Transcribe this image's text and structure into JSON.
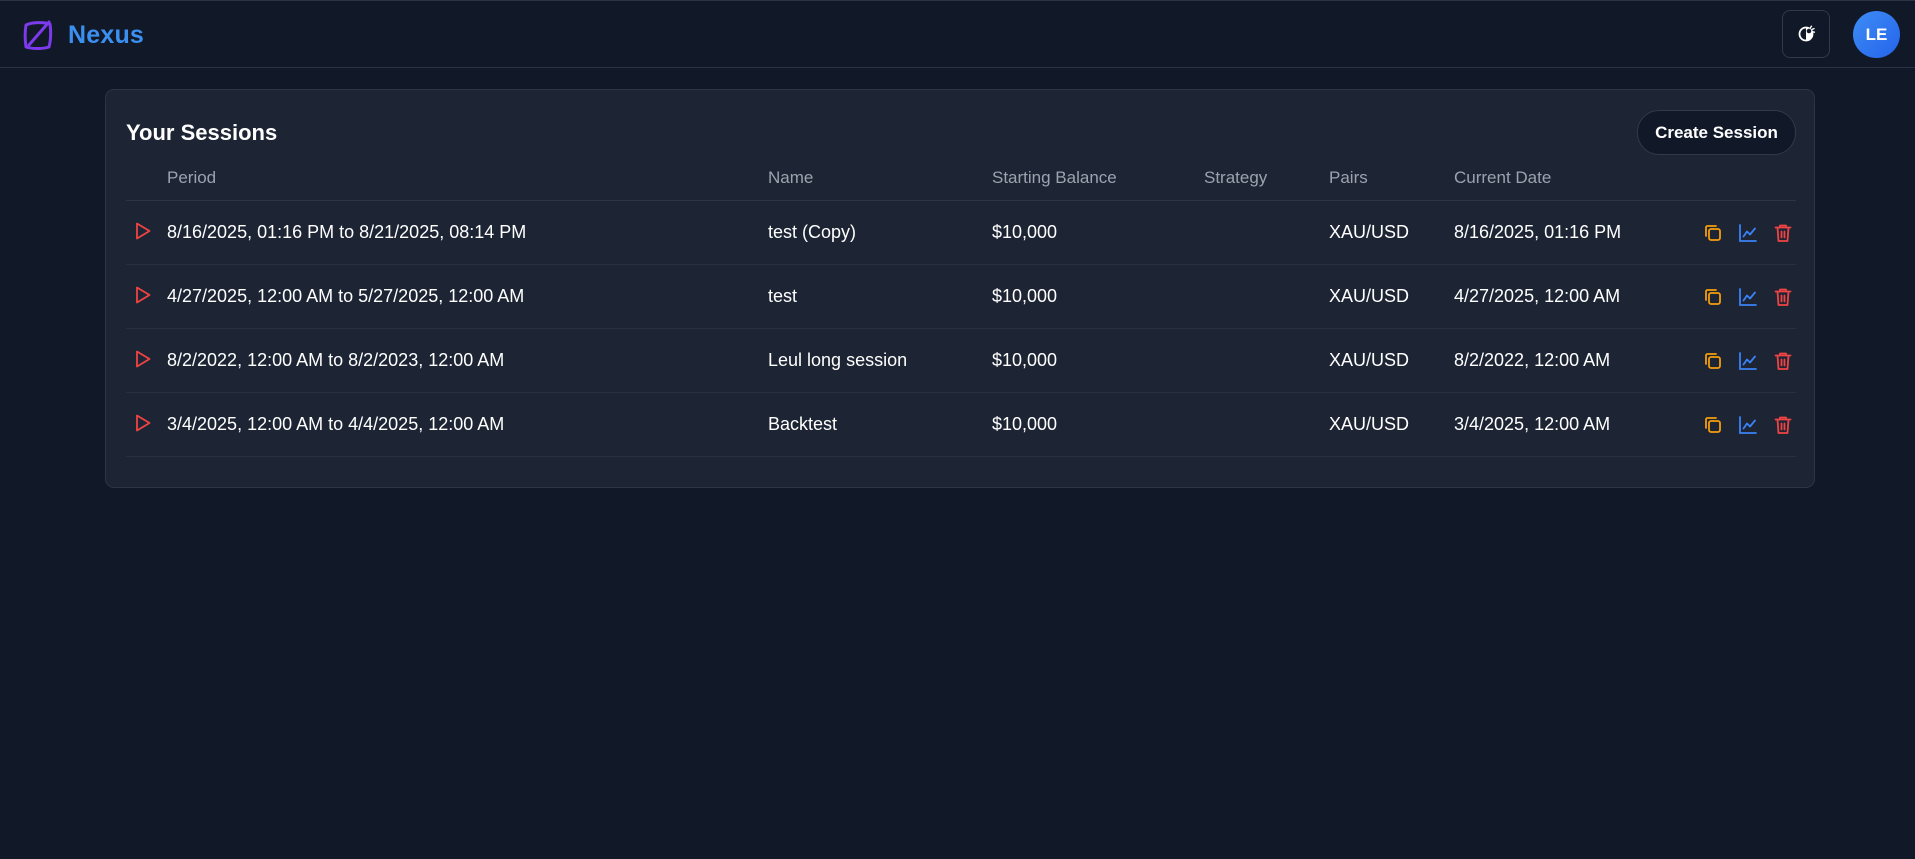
{
  "app": {
    "name": "Nexus",
    "user_initials": "LE",
    "colors": {
      "background": "#111827",
      "card": "#1d2433",
      "brand": "#3b8ff0",
      "logo": "#7c3aed",
      "play": "#ef4444",
      "copy": "#f59e0b",
      "chart": "#3b82f6",
      "delete": "#ef4444"
    },
    "icons": {
      "logo": "nexus-logo-icon",
      "theme": "theme-toggle-icon",
      "play": "play-icon",
      "copy": "copy-icon",
      "chart": "chart-icon",
      "delete": "trash-icon"
    }
  },
  "sessions": {
    "title": "Your Sessions",
    "create_label": "Create Session",
    "columns": {
      "period": "Period",
      "name": "Name",
      "starting_balance": "Starting Balance",
      "strategy": "Strategy",
      "pairs": "Pairs",
      "current_date": "Current Date"
    },
    "rows": [
      {
        "period": "8/16/2025, 01:16 PM to 8/21/2025, 08:14 PM",
        "name": "test (Copy)",
        "starting_balance": "$10,000",
        "strategy": "",
        "pairs": "XAU/USD",
        "current_date": "8/16/2025, 01:16 PM"
      },
      {
        "period": "4/27/2025, 12:00 AM to 5/27/2025, 12:00 AM",
        "name": "test",
        "starting_balance": "$10,000",
        "strategy": "",
        "pairs": "XAU/USD",
        "current_date": "4/27/2025, 12:00 AM"
      },
      {
        "period": "8/2/2022, 12:00 AM to 8/2/2023, 12:00 AM",
        "name": "Leul long session",
        "starting_balance": "$10,000",
        "strategy": "",
        "pairs": "XAU/USD",
        "current_date": "8/2/2022, 12:00 AM"
      },
      {
        "period": "3/4/2025, 12:00 AM to 4/4/2025, 12:00 AM",
        "name": "Backtest",
        "starting_balance": "$10,000",
        "strategy": "",
        "pairs": "XAU/USD",
        "current_date": "3/4/2025, 12:00 AM"
      }
    ]
  }
}
